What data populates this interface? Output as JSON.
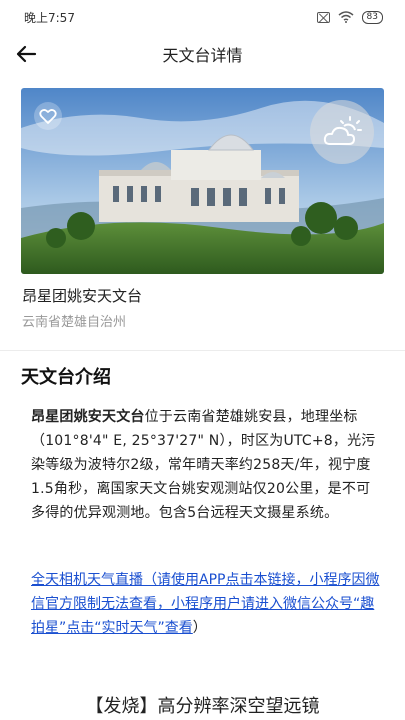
{
  "status_bar": {
    "time": "晚上7:57",
    "battery": "83"
  },
  "nav": {
    "title": "天文台详情"
  },
  "observatory": {
    "name": "昂星团姚安天文台",
    "region": "云南省楚雄自治州"
  },
  "intro": {
    "title": "天文台介绍",
    "name_bold": "昂星团姚安天文台",
    "text": "位于云南省楚雄姚安县，地理坐标（101°8'4\" E, 25°37'27\" N），时区为UTC+8，光污染等级为波特尔2级，常年晴天率约258天/年，视宁度1.5角秒，离国家天文台姚安观测站仅20公里，是不可多得的优异观测地。包含5台远程天文摄星系统。"
  },
  "live_link": {
    "text": "全天相机天气直播（请使用APP点击本链接，小程序因微信官方限制无法查看，小程序用户请进入微信公众号“趣拍星”点击“实时天气”查看",
    "tail": "）"
  },
  "ad": {
    "title": "【发烧】高分辨率深空望远镜"
  },
  "colors": {
    "link": "#1a4fd0",
    "sky_top": "#5a8fd0",
    "grass": "#3f7a2a"
  }
}
